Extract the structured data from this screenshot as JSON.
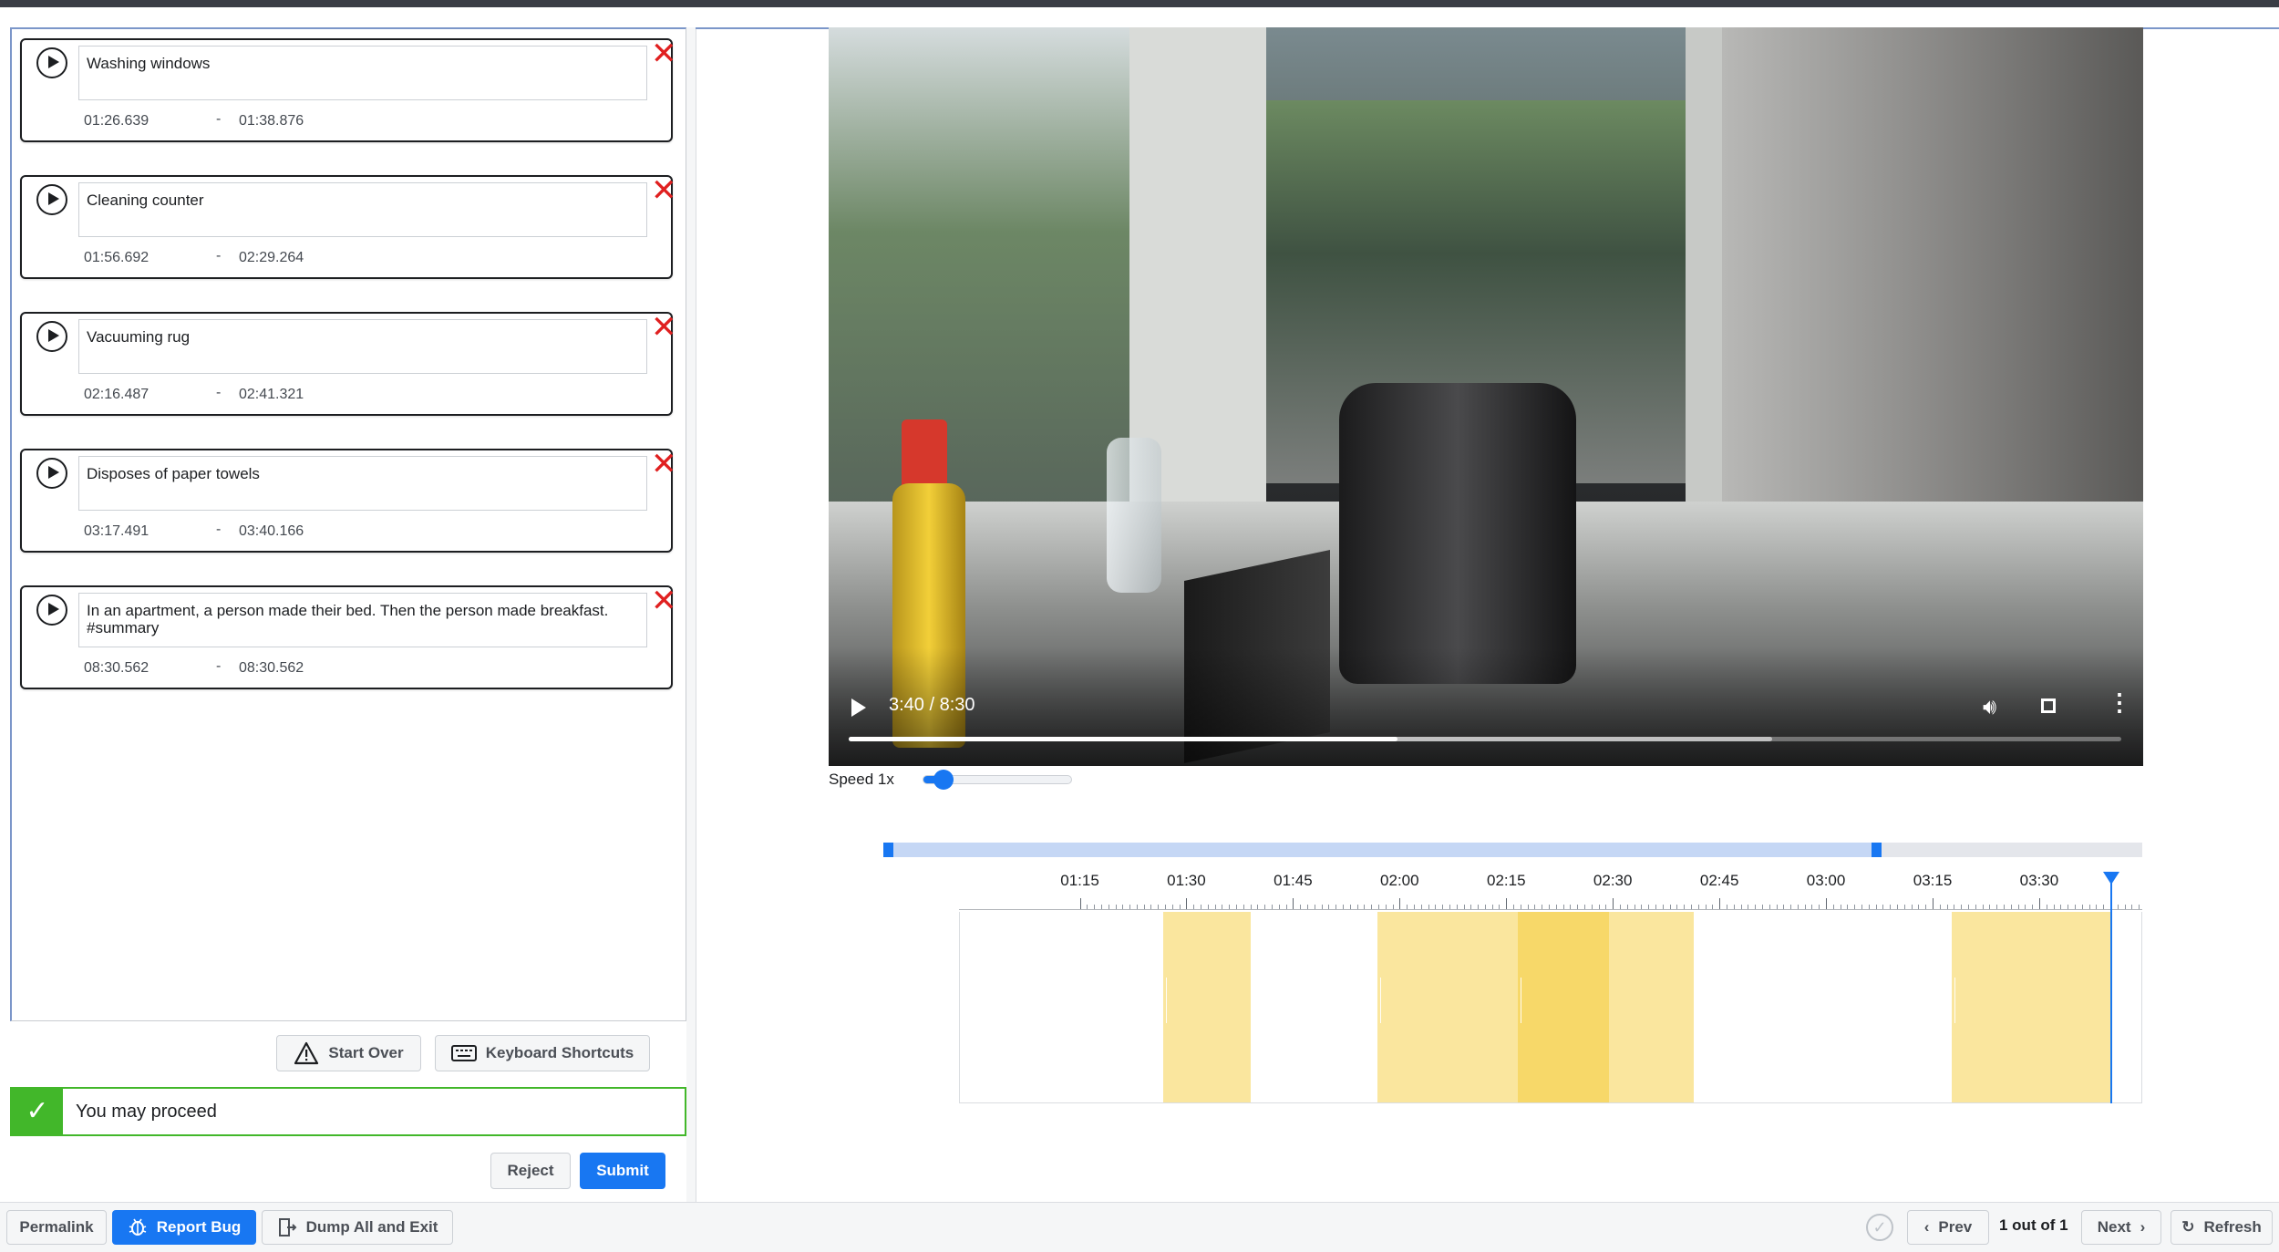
{
  "annotations": [
    {
      "text": "Washing windows",
      "start": "01:26.639",
      "end": "01:38.876"
    },
    {
      "text": "Cleaning counter",
      "start": "01:56.692",
      "end": "02:29.264"
    },
    {
      "text": "Vacuuming rug",
      "start": "02:16.487",
      "end": "02:41.321"
    },
    {
      "text": "Disposes of paper towels",
      "start": "03:17.491",
      "end": "03:40.166"
    },
    {
      "text": "In an apartment, a person made their bed. Then the person made breakfast. #summary",
      "start": "08:30.562",
      "end": "08:30.562"
    }
  ],
  "annotation_separator": "-",
  "actions": {
    "start_over": "Start Over",
    "keyboard_shortcuts": "Keyboard Shortcuts",
    "reject": "Reject",
    "submit": "Submit"
  },
  "status": {
    "message": "You may proceed",
    "color": "#42b72a"
  },
  "video": {
    "time_display": "3:40 / 8:30",
    "current_seconds": 220,
    "duration_seconds": 510,
    "buffered_seconds": 370
  },
  "speed": {
    "label": "Speed 1x",
    "value": 1,
    "min": 1,
    "max": 8
  },
  "timeline": {
    "tick_labels": [
      "01:15",
      "01:30",
      "01:45",
      "02:00",
      "02:15",
      "02:30",
      "02:45",
      "03:00",
      "03:15",
      "03:30"
    ],
    "view_start_seconds": 58,
    "view_end_seconds": 224.5,
    "scroll_window_seconds": [
      48,
      187
    ],
    "playhead_seconds": 220,
    "segments_seconds": [
      [
        86.6,
        98.9
      ],
      [
        116.7,
        149.3
      ],
      [
        136.5,
        161.3
      ],
      [
        197.5,
        220.2
      ]
    ],
    "segment_color": "#f4c828",
    "accent_color": "#1877f2"
  },
  "bottom_bar": {
    "permalink": "Permalink",
    "report_bug": "Report Bug",
    "dump_exit": "Dump All and Exit",
    "prev": "Prev",
    "pager": "1 out of 1",
    "next": "Next",
    "refresh": "Refresh"
  },
  "icons": {
    "play": "play-circle-icon",
    "close": "close-x-icon",
    "warning": "warning-triangle-icon",
    "keyboard": "keyboard-icon",
    "check": "checkmark-icon",
    "bug": "bug-icon",
    "exit": "exit-door-icon",
    "refresh": "refresh-icon"
  }
}
